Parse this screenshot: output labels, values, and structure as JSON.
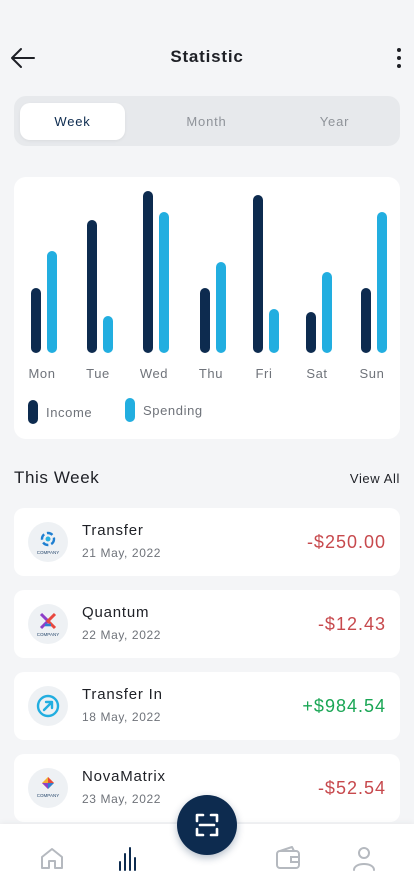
{
  "header": {
    "title": "Statistic",
    "back_icon": "arrow-left-icon",
    "more_icon": "more-vertical-icon"
  },
  "period_tabs": [
    {
      "label": "Week",
      "active": true
    },
    {
      "label": "Month",
      "active": false
    },
    {
      "label": "Year",
      "active": false
    }
  ],
  "colors": {
    "income": "#0d2b4f",
    "spending": "#22aee0",
    "negative": "#c7494d",
    "positive": "#1aa655"
  },
  "chart_data": {
    "type": "bar",
    "categories": [
      "Mon",
      "Tue",
      "Wed",
      "Thu",
      "Fri",
      "Sat",
      "Sun"
    ],
    "series": [
      {
        "name": "Income",
        "values": [
          65,
          133,
          162,
          65,
          158,
          41,
          65
        ]
      },
      {
        "name": "Spending",
        "values": [
          102,
          37,
          141,
          91,
          44,
          81,
          141
        ]
      }
    ],
    "ylim": [
      0,
      162
    ],
    "grid": false,
    "legend_position": "bottom-left"
  },
  "legend": [
    {
      "label": "Income"
    },
    {
      "label": "Spending"
    }
  ],
  "section": {
    "title": "This Week",
    "view_all": "View All"
  },
  "transactions": [
    {
      "name": "Transfer",
      "date": "21 May, 2022",
      "amount": "-$250.00",
      "type": "negative",
      "logo": "company-swirl-logo",
      "logo_text": "COMPANY"
    },
    {
      "name": "Quantum",
      "date": "22 May, 2022",
      "amount": "-$12.43",
      "type": "negative",
      "logo": "company-x-logo",
      "logo_text": "COMPANY"
    },
    {
      "name": "Transfer In",
      "date": "18 May, 2022",
      "amount": "+$984.54",
      "type": "positive",
      "logo": "arrow-up-right-icon"
    },
    {
      "name": "NovaMatrix",
      "date": "23 May, 2022",
      "amount": "-$52.54",
      "type": "negative",
      "logo": "company-diamond-logo",
      "logo_text": "COMPANY"
    }
  ],
  "bottom_nav": [
    {
      "icon": "home-icon"
    },
    {
      "icon": "chart-icon",
      "active": true
    },
    {
      "icon": "scan-icon"
    },
    {
      "icon": "wallet-icon"
    },
    {
      "icon": "profile-icon"
    }
  ]
}
